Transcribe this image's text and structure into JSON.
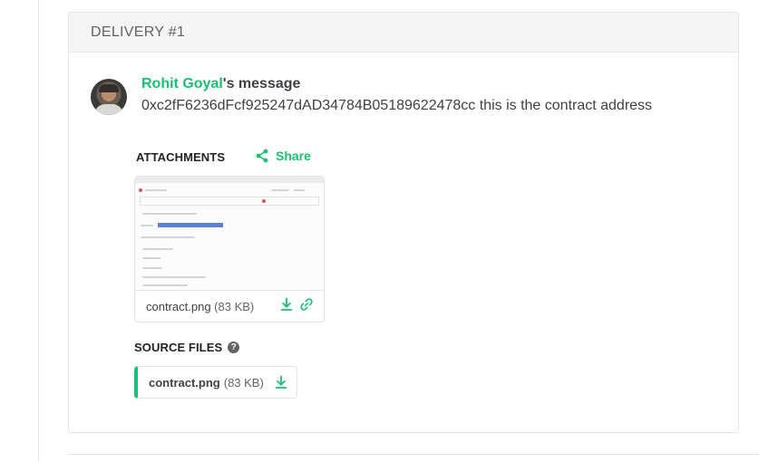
{
  "delivery": {
    "title": "DELIVERY #1"
  },
  "message": {
    "sender": "Rohit Goyal",
    "suffix": "'s message",
    "body": "0xc2fF6236dFcf925247dAD34784B05189622478cc this is the contract address"
  },
  "attachments": {
    "label": "ATTACHMENTS",
    "share_label": "Share",
    "share_icon": "share-icon",
    "files": [
      {
        "name": "contract.png",
        "size": "(83 KB)",
        "icons": [
          "download-icon",
          "link-icon"
        ]
      }
    ]
  },
  "source_files": {
    "label": "SOURCE FILES",
    "help_icon": "question-circle-icon",
    "help_glyph": "?",
    "files": [
      {
        "name": "contract.png",
        "size": "(83 KB)",
        "icon": "download-icon"
      }
    ]
  },
  "colors": {
    "accent": "#1dbf73",
    "text": "#404145",
    "muted": "#62646a",
    "border": "#e4e5e7",
    "header_bg": "#f5f5f5"
  }
}
